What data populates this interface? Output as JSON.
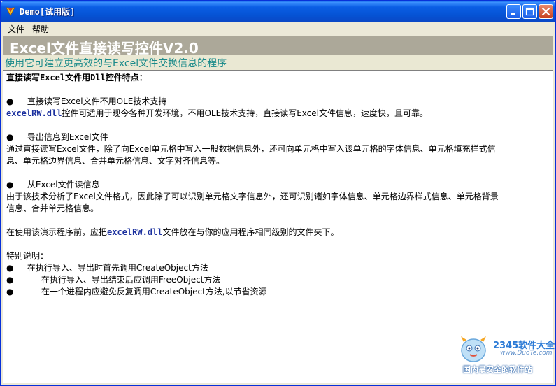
{
  "window": {
    "title": "Demo[试用版]"
  },
  "menu": {
    "file": "文件",
    "help": "帮助"
  },
  "banner": {
    "title": "Excel文件直接读写控件V2.0",
    "subtitle": "使用它可建立更高效的与Excel文件交换信息的程序"
  },
  "content": {
    "heading": "直接读写Excel文件用Dll控件特点：",
    "bullet_glyph": "●",
    "feature1_title": "直接读写Excel文件不用OLE技术支持",
    "feature1_dll": "excelRW.dll",
    "feature1_desc": "控件可适用于现今各种开发环境，不用OLE技术支持，直接读写Excel文件信息，速度快，且可靠。",
    "feature2_title": "导出信息到Excel文件",
    "feature2_desc_line1": " 通过直接读写Excel文件，除了向Excel单元格中写入一般数据信息外，还可向单元格中写入该单元格的字体信息、单元格填充样式信",
    "feature2_desc_line2": "息、单元格边界信息、合并单元格信息、文字对齐信息等。",
    "feature3_title": "从Excel文件读信息",
    "feature3_desc_line1": " 由于该技术分析了Excel文件格式，因此除了可以识别单元格文字信息外，还可识别诸如字体信息、单元格边界样式信息、单元格背景",
    "feature3_desc_line2": "信息、合并单元格信息。",
    "usage_prefix": "在使用该演示程序前，应把",
    "usage_dll": "excelRW.dll",
    "usage_suffix": "文件放在与你的应用程序相同级别的文件夹下。",
    "notes_title": "特别说明：",
    "note1": "在执行导入、导出时首先调用CreateObject方法",
    "note2": "在执行导入、导出结束后应调用FreeObject方法",
    "note3": "在一个进程内应避免反复调用CreateObject方法,以节省资源"
  },
  "watermark": {
    "brand": "2345软件大全",
    "url": "www.DuoTe.com",
    "slogan": "国内最安全的软件站"
  },
  "colors": {
    "titlebar": "#0553d4",
    "banner": "#aca899",
    "subtitle_text": "#1a8a8a",
    "dll_text": "#1a2f9e"
  },
  "icons": {
    "app": "app-icon",
    "minimize": "minimize-icon",
    "maximize": "maximize-icon",
    "close": "close-icon"
  }
}
